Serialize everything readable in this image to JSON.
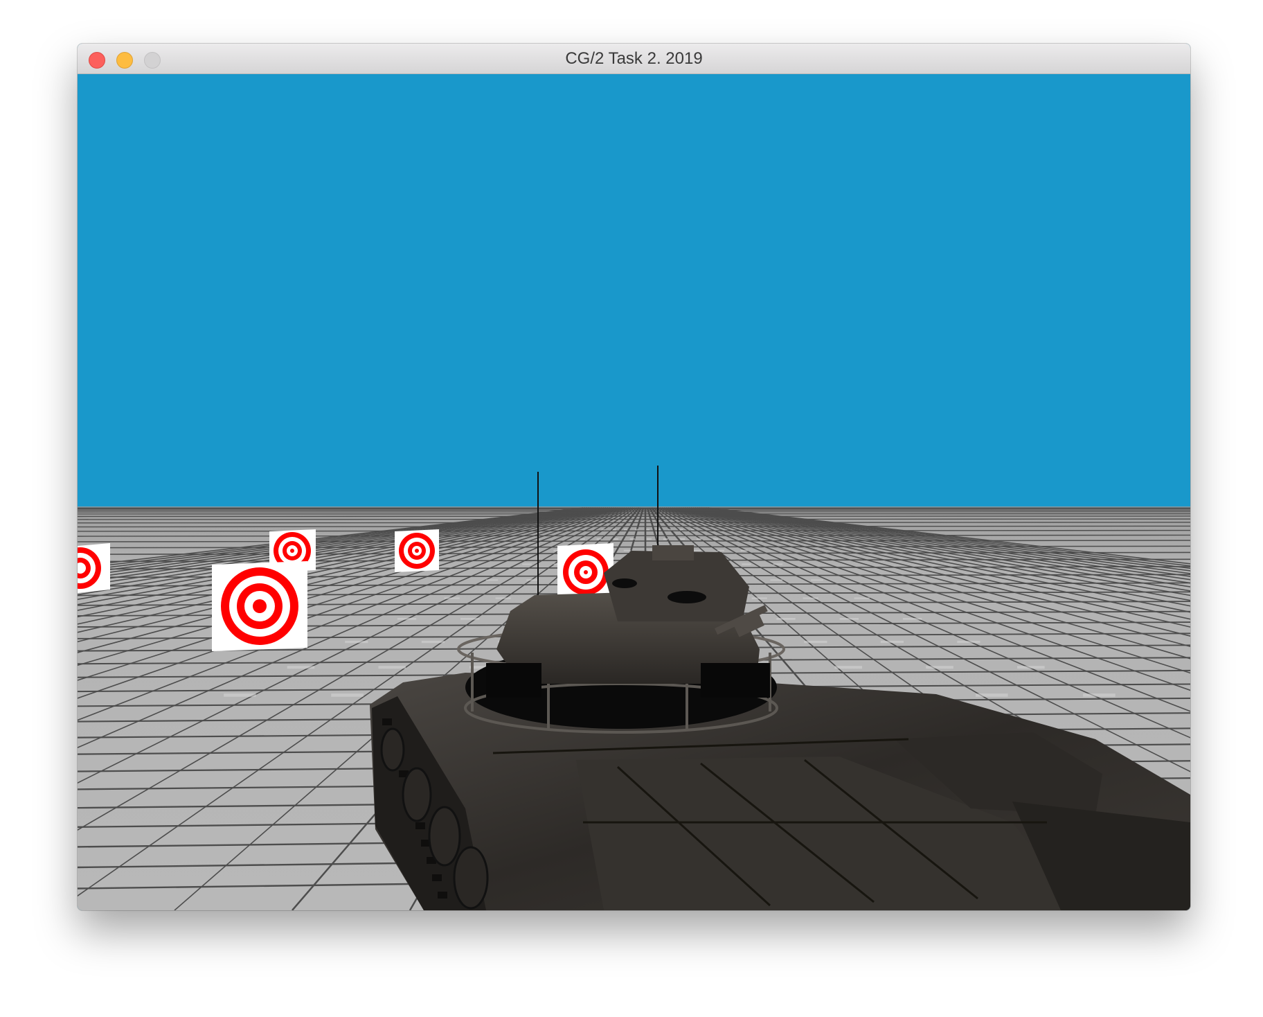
{
  "window": {
    "title": "CG/2 Task 2. 2019"
  },
  "scene": {
    "sky_color": "#1998cb",
    "ground_color": "#b5b5b5",
    "grid_line_color": "#4a4a4a",
    "target_ring_color": "#ff0000",
    "target_bg_color": "#ffffff",
    "tank_color": "#2e2b28"
  },
  "icons": {
    "close": "close-button-icon",
    "minimize": "minimize-button-icon",
    "maximize": "maximize-button-icon"
  }
}
